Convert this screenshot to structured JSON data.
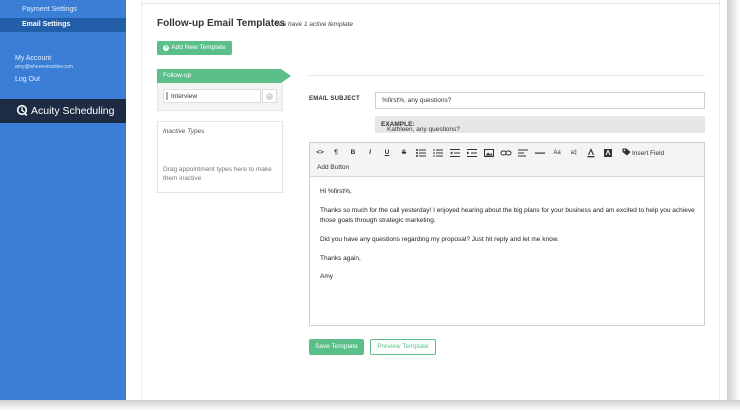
{
  "sidebar": {
    "payment_settings": "Payment Settings",
    "email_settings": "Email Settings",
    "my_account": "My Account",
    "account_email": "amy@whereverwriter.com",
    "log_out": "Log Out",
    "brand": "Acuity Scheduling"
  },
  "main": {
    "title": "Follow-up Email Templates",
    "subtitle": "You have 1 active template",
    "add_template": "Add New Template",
    "followup_tab": "Follow-up",
    "interview_label": "Interview",
    "remove_icon": "×",
    "inactive_title": "Inactive Types",
    "inactive_desc": "Drag appointment types here to make them inactive",
    "subject_label": "EMAIL SUBJECT",
    "subject_value": "%first%, any questions?",
    "example_prefix": "EXAMPLE:",
    "example_value": "Kathleen, any questions?",
    "save_label": "Save Template",
    "preview_label": "Preview Template"
  },
  "editor": {
    "toolbar": {
      "code": "<>",
      "paragraph": "¶",
      "bold": "B",
      "italic": "I",
      "underline": "U",
      "strike": "S",
      "insert_field": "Insert Field",
      "add_button": "Add Button"
    },
    "body": [
      "Hi %first%,",
      "Thanks so much for the call yesterday! I enjoyed hearing about the big plans for your business and am excited to help you achieve those goals through strategic marketing.",
      "Did you have any questions regarding my proposal? Just hit reply and let me know.",
      "Thanks again,",
      "Amy"
    ]
  },
  "colors": {
    "sidebar": "#3a7fd5",
    "sidebar_active": "#235fa8",
    "brand_bar": "#1e2c43",
    "accent_green": "#5bbf8a"
  }
}
